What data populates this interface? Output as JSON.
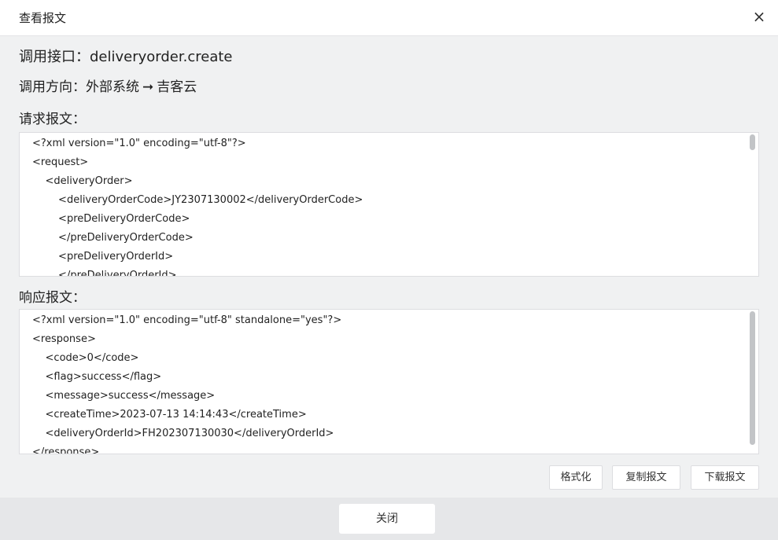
{
  "dialog": {
    "title": "查看报文",
    "close_icon": "×"
  },
  "info": {
    "interface_label": "调用接口：",
    "interface_value": "deliveryorder.create",
    "direction_label": "调用方向：",
    "direction_from": "外部系统",
    "direction_arrow": "➞",
    "direction_to": "吉客云"
  },
  "request": {
    "label": "请求报文：",
    "content": "<?xml version=\"1.0\" encoding=\"utf-8\"?>\n<request>\n    <deliveryOrder>\n        <deliveryOrderCode>JY2307130002</deliveryOrderCode>\n        <preDeliveryOrderCode>\n        </preDeliveryOrderCode>\n        <preDeliveryOrderId>\n        </preDeliveryOrderId>"
  },
  "response": {
    "label": "响应报文：",
    "content": "<?xml version=\"1.0\" encoding=\"utf-8\" standalone=\"yes\"?>\n<response>\n    <code>0</code>\n    <flag>success</flag>\n    <message>success</message>\n    <createTime>2023-07-13 14:14:43</createTime>\n    <deliveryOrderId>FH202307130030</deliveryOrderId>\n</response>"
  },
  "actions": {
    "format": "格式化",
    "copy": "复制报文",
    "download": "下载报文"
  },
  "footer": {
    "close": "关闭"
  },
  "colors": {
    "background": "#f0f1f2",
    "panel": "#ffffff",
    "border": "#dcdde0",
    "scroll_thumb": "#c2c4c7",
    "footer": "#e6e7e9"
  }
}
